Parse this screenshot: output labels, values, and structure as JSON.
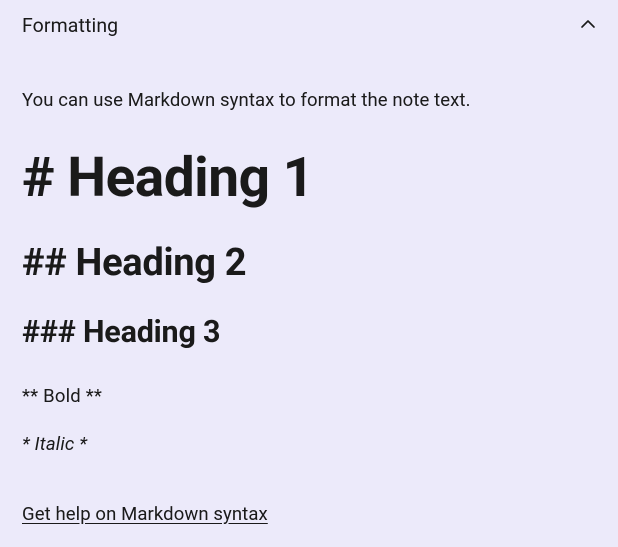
{
  "panel": {
    "title": "Formatting",
    "intro": "You can use Markdown syntax to format the note text.",
    "examples": {
      "heading1": "# Heading 1",
      "heading2": "## Heading 2",
      "heading3": "### Heading 3",
      "bold": "** Bold **",
      "italic": "* Italic *"
    },
    "help_link": "Get help on Markdown syntax"
  }
}
